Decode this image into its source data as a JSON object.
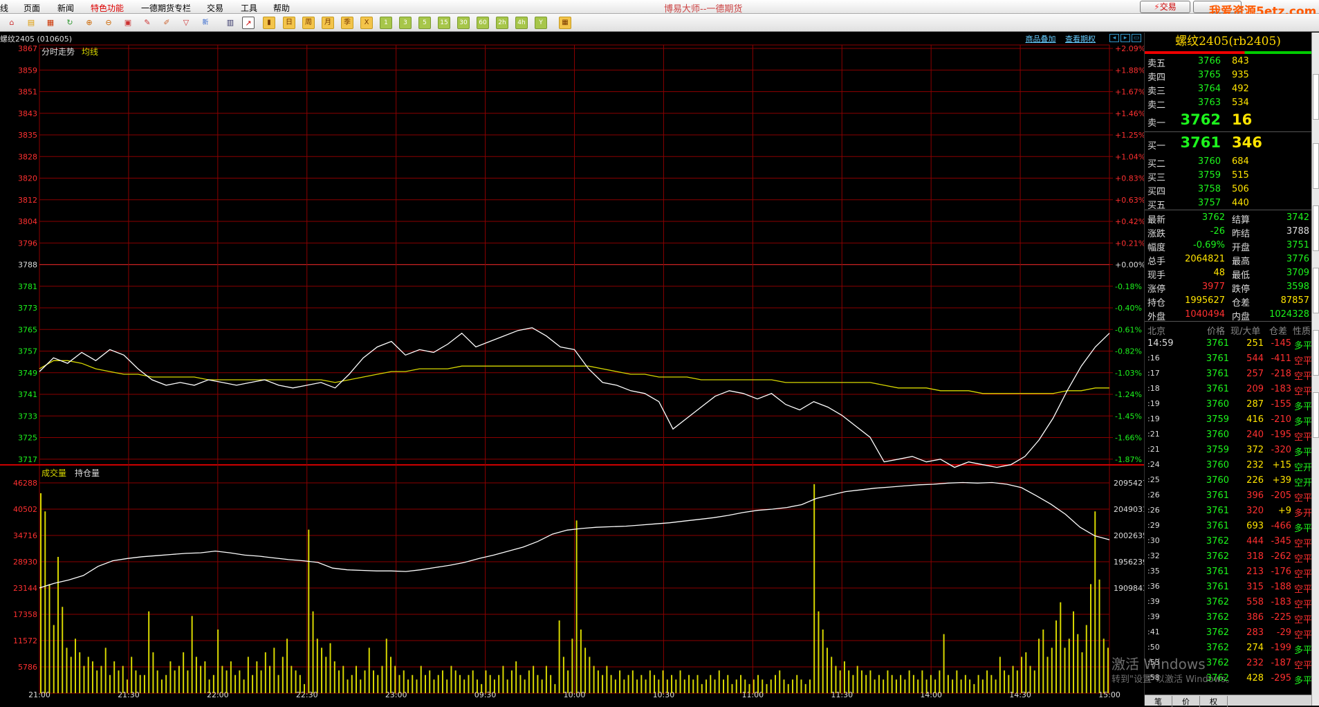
{
  "menu": {
    "items": [
      "线",
      "页面",
      "新闻",
      "特色功能",
      "一德期货专栏",
      "交易",
      "工具",
      "帮助"
    ],
    "active_index": 3,
    "app_title": "博易大师--一德期货",
    "trade_button": "交易",
    "site_watermark": "我爱资源5etz.com"
  },
  "toolbar": {
    "icons": [
      "home-icon",
      "folder-icon",
      "news-icon",
      "refresh-icon",
      "zoom-in-icon",
      "zoom-out-icon",
      "window-icon",
      "pen-icon",
      "brush-icon",
      "filter-icon",
      "new-icon",
      "table-icon",
      "chart-icon",
      "kline-icon"
    ],
    "period_buttons": [
      "日",
      "周",
      "月",
      "季",
      "X",
      "1",
      "3",
      "5",
      "15",
      "30",
      "60",
      "2h",
      "4h",
      "Y"
    ],
    "calc_icon": "calculator-icon"
  },
  "chart": {
    "symbol_label": "螺纹2405 (010605)",
    "links": [
      "商品叠加",
      "查看期权"
    ],
    "price_panel_title": "分时走势",
    "price_panel_avg": "均线",
    "volume_panel_title": "成交量",
    "volume_panel_oi": "持仓量",
    "accent_colors": {
      "price_line": "#ffffff",
      "avg_line": "#d8d800",
      "grid": "#8b0000",
      "up": "#ff3030",
      "down": "#1df51d",
      "volume": "#d8d800"
    }
  },
  "chart_data": {
    "type": "line",
    "title": "分时走势",
    "prev_settle": 3788,
    "price_axis_left": [
      3867,
      3859,
      3851,
      3843,
      3835,
      3828,
      3820,
      3812,
      3804,
      3796,
      3788,
      3781,
      3773,
      3765,
      3757,
      3749,
      3741,
      3733,
      3725,
      3717
    ],
    "pct_axis_right": [
      "+2.09%",
      "+1.88%",
      "+1.67%",
      "+1.46%",
      "+1.25%",
      "+1.04%",
      "+0.83%",
      "+0.63%",
      "+0.42%",
      "+0.21%",
      "+0.00%",
      "-0.18%",
      "-0.40%",
      "-0.61%",
      "-0.82%",
      "-1.03%",
      "-1.24%",
      "-1.45%",
      "-1.66%",
      "-1.87%"
    ],
    "x_ticks": [
      "21:00",
      "21:30",
      "22:00",
      "22:30",
      "23:00",
      "09:30",
      "10:00",
      "10:30",
      "11:00",
      "11:30",
      "14:00",
      "14:30",
      "15:00"
    ],
    "series": [
      {
        "name": "分时走势",
        "values": [
          3749,
          3754,
          3752,
          3756,
          3753,
          3757,
          3755,
          3750,
          3746,
          3744,
          3745,
          3744,
          3746,
          3745,
          3744,
          3745,
          3746,
          3744,
          3743,
          3744,
          3745,
          3743,
          3748,
          3754,
          3758,
          3760,
          3755,
          3757,
          3756,
          3759,
          3763,
          3758,
          3760,
          3762,
          3764,
          3765,
          3762,
          3758,
          3757,
          3750,
          3745,
          3744,
          3742,
          3741,
          3738,
          3728,
          3732,
          3736,
          3740,
          3742,
          3741,
          3739,
          3741,
          3737,
          3735,
          3738,
          3736,
          3733,
          3729,
          3725,
          3716,
          3717,
          3718,
          3716,
          3717,
          3714,
          3716,
          3715,
          3714,
          3715,
          3718,
          3724,
          3732,
          3742,
          3751,
          3758,
          3763
        ]
      },
      {
        "name": "均线",
        "values": [
          3750,
          3753,
          3753,
          3752,
          3750,
          3749,
          3748,
          3748,
          3747,
          3747,
          3747,
          3747,
          3746,
          3746,
          3746,
          3746,
          3746,
          3746,
          3746,
          3746,
          3746,
          3745,
          3746,
          3747,
          3748,
          3749,
          3749,
          3750,
          3750,
          3750,
          3751,
          3751,
          3751,
          3751,
          3751,
          3751,
          3751,
          3751,
          3751,
          3751,
          3750,
          3749,
          3748,
          3748,
          3747,
          3747,
          3747,
          3746,
          3746,
          3746,
          3746,
          3746,
          3746,
          3745,
          3745,
          3745,
          3745,
          3745,
          3745,
          3745,
          3744,
          3743,
          3743,
          3743,
          3742,
          3742,
          3742,
          3741,
          3741,
          3741,
          3741,
          3741,
          3741,
          3742,
          3742,
          3743,
          3743
        ]
      }
    ],
    "volume_axis_left": [
      46288,
      40502,
      34716,
      28930,
      23144,
      17358,
      11572,
      5786
    ],
    "oi_axis_right": [
      2095427,
      2049031,
      2002635,
      1956239,
      1909843
    ],
    "volume_values": [
      44000,
      40000,
      24000,
      15000,
      30000,
      19000,
      10000,
      8000,
      12000,
      9000,
      6000,
      8000,
      7000,
      5000,
      6000,
      10000,
      4000,
      7000,
      5000,
      6000,
      3000,
      8000,
      5000,
      4000,
      4000,
      18000,
      9000,
      5000,
      3000,
      4000,
      7000,
      5000,
      6000,
      9000,
      5000,
      17000,
      8000,
      6000,
      7000,
      3000,
      4000,
      14000,
      6000,
      5000,
      7000,
      4000,
      5000,
      3000,
      8000,
      4000,
      7000,
      5000,
      9000,
      6000,
      10000,
      4000,
      8000,
      12000,
      6000,
      5000,
      4000,
      2000,
      36000,
      18000,
      12000,
      10000,
      8000,
      11000,
      7000,
      5000,
      6000,
      3000,
      4000,
      6000,
      3000,
      5000,
      10000,
      5000,
      4000,
      6000,
      12000,
      8000,
      6000,
      4000,
      5000,
      3000,
      4000,
      3000,
      6000,
      4000,
      5000,
      3000,
      4000,
      5000,
      3000,
      6000,
      5000,
      4000,
      3000,
      4000,
      5000,
      3000,
      2000,
      5000,
      4000,
      3000,
      4000,
      6000,
      3000,
      5000,
      7000,
      4000,
      3000,
      5000,
      6000,
      4000,
      3000,
      6000,
      4000,
      2000,
      16000,
      8000,
      5000,
      12000,
      38000,
      14000,
      10000,
      8000,
      6000,
      5000,
      4000,
      6000,
      4000,
      3000,
      5000,
      3000,
      4000,
      5000,
      3000,
      4000,
      3000,
      5000,
      4000,
      3000,
      5000,
      3000,
      4000,
      3000,
      5000,
      3000,
      4000,
      3000,
      4000,
      2000,
      3000,
      4000,
      3000,
      5000,
      3000,
      4000,
      2000,
      3000,
      4000,
      3000,
      2000,
      3000,
      4000,
      3000,
      2000,
      3000,
      4000,
      5000,
      3000,
      2000,
      3000,
      4000,
      3000,
      2000,
      3000,
      46000,
      18000,
      14000,
      10000,
      8000,
      6000,
      5000,
      7000,
      5000,
      4000,
      6000,
      5000,
      4000,
      5000,
      3000,
      4000,
      3000,
      5000,
      4000,
      3000,
      4000,
      3000,
      5000,
      4000,
      3000,
      5000,
      3000,
      4000,
      3000,
      5000,
      13000,
      4000,
      3000,
      5000,
      3000,
      4000,
      3000,
      2000,
      4000,
      3000,
      5000,
      4000,
      3000,
      8000,
      5000,
      4000,
      6000,
      5000,
      8000,
      9000,
      6000,
      5000,
      12000,
      14000,
      8000,
      10000,
      16000,
      20000,
      10000,
      12000,
      18000,
      13000,
      9000,
      15000,
      24000,
      40000,
      25000,
      12000,
      10000
    ],
    "oi_values": [
      1910000,
      1918000,
      1924000,
      1932000,
      1948000,
      1958000,
      1962000,
      1965000,
      1967000,
      1969000,
      1971000,
      1972000,
      1975000,
      1972000,
      1968000,
      1966000,
      1963000,
      1960000,
      1958000,
      1955000,
      1945000,
      1942000,
      1941000,
      1940000,
      1940000,
      1939000,
      1942000,
      1946000,
      1950000,
      1955000,
      1962000,
      1968000,
      1975000,
      1982000,
      1992000,
      2005000,
      2012000,
      2015000,
      2017000,
      2018000,
      2019000,
      2021000,
      2023000,
      2025000,
      2028000,
      2031000,
      2034000,
      2038000,
      2043000,
      2047000,
      2049000,
      2052000,
      2057000,
      2068000,
      2074000,
      2080000,
      2083000,
      2086000,
      2088000,
      2090000,
      2092000,
      2093000,
      2095000,
      2096000,
      2095000,
      2096000,
      2093000,
      2087000,
      2073000,
      2058000,
      2040000,
      2017000,
      2002000,
      1995000
    ]
  },
  "quote_panel": {
    "title": "螺纹2405(rb2405)",
    "asks": [
      {
        "label": "卖五",
        "price": "3766",
        "vol": "843"
      },
      {
        "label": "卖四",
        "price": "3765",
        "vol": "935"
      },
      {
        "label": "卖三",
        "price": "3764",
        "vol": "492"
      },
      {
        "label": "卖二",
        "price": "3763",
        "vol": "534"
      }
    ],
    "ask1": {
      "label": "卖一",
      "price": "3762",
      "vol": "16"
    },
    "bid1": {
      "label": "买一",
      "price": "3761",
      "vol": "346"
    },
    "bids": [
      {
        "label": "买二",
        "price": "3760",
        "vol": "684"
      },
      {
        "label": "买三",
        "price": "3759",
        "vol": "515"
      },
      {
        "label": "买四",
        "price": "3758",
        "vol": "506"
      },
      {
        "label": "买五",
        "price": "3757",
        "vol": "440"
      }
    ],
    "stats": [
      {
        "l1": "最新",
        "v1": "3762",
        "c1": "#1df51d",
        "l2": "结算",
        "v2": "3742",
        "c2": "#1df51d"
      },
      {
        "l1": "涨跌",
        "v1": "-26",
        "c1": "#1df51d",
        "l2": "昨结",
        "v2": "3788",
        "c2": "#dddddd"
      },
      {
        "l1": "幅度",
        "v1": "-0.69%",
        "c1": "#1df51d",
        "l2": "开盘",
        "v2": "3751",
        "c2": "#1df51d"
      },
      {
        "l1": "总手",
        "v1": "2064821",
        "c1": "#ffe400",
        "l2": "最高",
        "v2": "3776",
        "c2": "#1df51d"
      },
      {
        "l1": "现手",
        "v1": "48",
        "c1": "#ffe400",
        "l2": "最低",
        "v2": "3709",
        "c2": "#1df51d"
      },
      {
        "l1": "涨停",
        "v1": "3977",
        "c1": "#ff3030",
        "l2": "跌停",
        "v2": "3598",
        "c2": "#1df51d"
      },
      {
        "l1": "持仓",
        "v1": "1995627",
        "c1": "#ffe400",
        "l2": "仓差",
        "v2": "87857",
        "c2": "#ffe400"
      },
      {
        "l1": "外盘",
        "v1": "1040494",
        "c1": "#ff3030",
        "l2": "内盘",
        "v2": "1024328",
        "c2": "#1df51d"
      }
    ],
    "tick_header": [
      "北京",
      "价格",
      "现/大单",
      "仓差",
      "性质"
    ],
    "ticks": [
      {
        "t": "14:59",
        "p": "3761",
        "v": "251",
        "d": "-145",
        "ty": "多平",
        "vc": "#ffe400",
        "dc": "#ff3030",
        "tc": "#1df51d"
      },
      {
        "t": ":16",
        "p": "3761",
        "v": "544",
        "d": "-411",
        "ty": "空平",
        "vc": "#ff3030",
        "dc": "#ff3030",
        "tc": "#ff3030"
      },
      {
        "t": ":17",
        "p": "3761",
        "v": "257",
        "d": "-218",
        "ty": "空平",
        "vc": "#ff3030",
        "dc": "#ff3030",
        "tc": "#ff3030"
      },
      {
        "t": ":18",
        "p": "3761",
        "v": "209",
        "d": "-183",
        "ty": "空平",
        "vc": "#ff3030",
        "dc": "#ff3030",
        "tc": "#ff3030"
      },
      {
        "t": ":19",
        "p": "3760",
        "v": "287",
        "d": "-155",
        "ty": "多平",
        "vc": "#ffe400",
        "dc": "#ff3030",
        "tc": "#1df51d"
      },
      {
        "t": ":19",
        "p": "3759",
        "v": "416",
        "d": "-210",
        "ty": "多平",
        "vc": "#ffe400",
        "dc": "#ff3030",
        "tc": "#1df51d"
      },
      {
        "t": ":21",
        "p": "3760",
        "v": "240",
        "d": "-195",
        "ty": "空平",
        "vc": "#ff3030",
        "dc": "#ff3030",
        "tc": "#ff3030"
      },
      {
        "t": ":21",
        "p": "3759",
        "v": "372",
        "d": "-320",
        "ty": "多平",
        "vc": "#ffe400",
        "dc": "#ff3030",
        "tc": "#1df51d"
      },
      {
        "t": ":24",
        "p": "3760",
        "v": "232",
        "d": "+15",
        "ty": "空开",
        "vc": "#ffe400",
        "dc": "#ffe400",
        "tc": "#1df51d"
      },
      {
        "t": ":25",
        "p": "3760",
        "v": "226",
        "d": "+39",
        "ty": "空开",
        "vc": "#ffe400",
        "dc": "#ffe400",
        "tc": "#1df51d"
      },
      {
        "t": ":26",
        "p": "3761",
        "v": "396",
        "d": "-205",
        "ty": "空平",
        "vc": "#ff3030",
        "dc": "#ff3030",
        "tc": "#ff3030"
      },
      {
        "t": ":26",
        "p": "3761",
        "v": "320",
        "d": "+9",
        "ty": "多开",
        "vc": "#ff3030",
        "dc": "#ffe400",
        "tc": "#ff3030"
      },
      {
        "t": ":29",
        "p": "3761",
        "v": "693",
        "d": "-466",
        "ty": "多平",
        "vc": "#ffe400",
        "dc": "#ff3030",
        "tc": "#1df51d"
      },
      {
        "t": ":30",
        "p": "3762",
        "v": "444",
        "d": "-345",
        "ty": "空平",
        "vc": "#ff3030",
        "dc": "#ff3030",
        "tc": "#ff3030"
      },
      {
        "t": ":32",
        "p": "3762",
        "v": "318",
        "d": "-262",
        "ty": "空平",
        "vc": "#ff3030",
        "dc": "#ff3030",
        "tc": "#ff3030"
      },
      {
        "t": ":35",
        "p": "3761",
        "v": "213",
        "d": "-176",
        "ty": "空平",
        "vc": "#ff3030",
        "dc": "#ff3030",
        "tc": "#ff3030"
      },
      {
        "t": ":36",
        "p": "3761",
        "v": "315",
        "d": "-188",
        "ty": "空平",
        "vc": "#ff3030",
        "dc": "#ff3030",
        "tc": "#ff3030"
      },
      {
        "t": ":39",
        "p": "3762",
        "v": "558",
        "d": "-183",
        "ty": "空平",
        "vc": "#ff3030",
        "dc": "#ff3030",
        "tc": "#ff3030"
      },
      {
        "t": ":39",
        "p": "3762",
        "v": "386",
        "d": "-225",
        "ty": "空平",
        "vc": "#ff3030",
        "dc": "#ff3030",
        "tc": "#ff3030"
      },
      {
        "t": ":41",
        "p": "3762",
        "v": "283",
        "d": "-29",
        "ty": "空平",
        "vc": "#ff3030",
        "dc": "#ff3030",
        "tc": "#ff3030"
      },
      {
        "t": ":50",
        "p": "3762",
        "v": "274",
        "d": "-199",
        "ty": "多平",
        "vc": "#ffe400",
        "dc": "#ff3030",
        "tc": "#1df51d"
      },
      {
        "t": ":53",
        "p": "3762",
        "v": "232",
        "d": "-187",
        "ty": "空平",
        "vc": "#ff3030",
        "dc": "#ff3030",
        "tc": "#ff3030"
      },
      {
        "t": ":58",
        "p": "3762",
        "v": "428",
        "d": "-295",
        "ty": "多平",
        "vc": "#ffe400",
        "dc": "#ff3030",
        "tc": "#1df51d"
      }
    ],
    "tabs": [
      "笔",
      "价",
      "权"
    ]
  },
  "windows_watermark": {
    "line1": "激活 Windows",
    "line2": "转到\"设置\"以激活 Windows。"
  }
}
